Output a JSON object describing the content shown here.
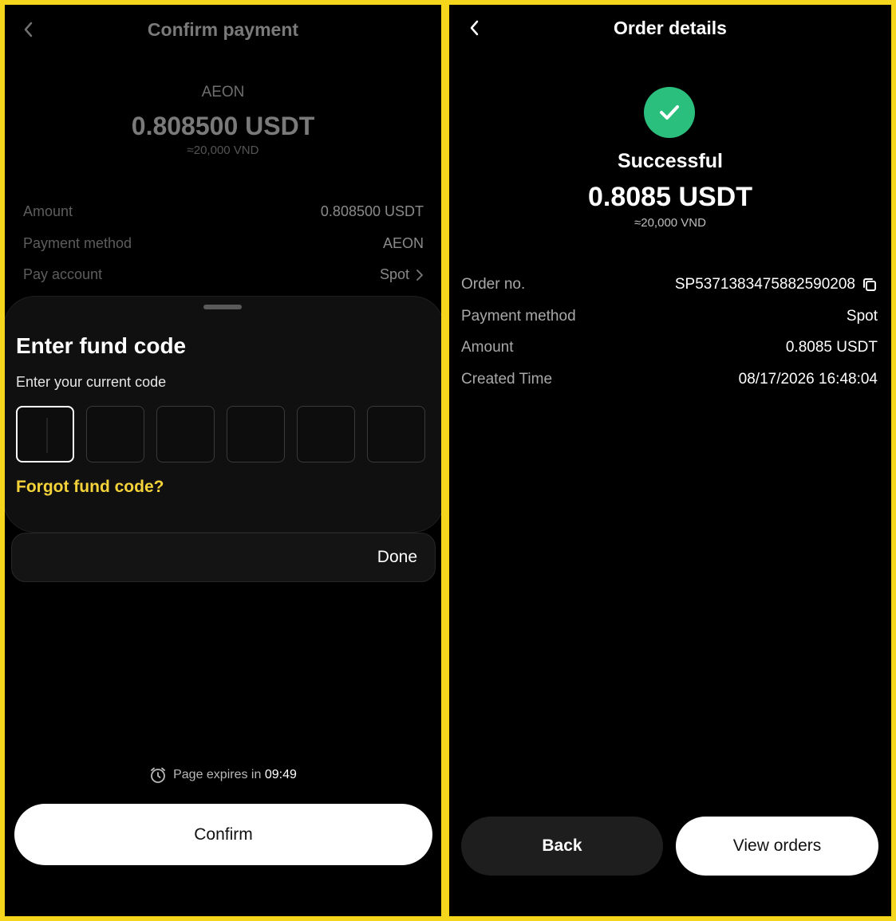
{
  "left": {
    "title": "Confirm payment",
    "merchant": "AEON",
    "amount": "0.808500 USDT",
    "approx": "≈20,000 VND",
    "rows": [
      {
        "label": "Amount",
        "value": "0.808500 USDT"
      },
      {
        "label": "Payment method",
        "value": "AEON"
      },
      {
        "label": "Pay account",
        "value": "Spot"
      }
    ],
    "sheet": {
      "title": "Enter fund code",
      "subtitle": "Enter your current code",
      "forgot": "Forgot fund code?",
      "done": "Done"
    },
    "expires_label": "Page expires in",
    "expires_time": "09:49",
    "confirm_label": "Confirm"
  },
  "right": {
    "title": "Order details",
    "status": "Successful",
    "amount": "0.8085 USDT",
    "approx": "≈20,000 VND",
    "rows": [
      {
        "label": "Order no.",
        "value": "SP5371383475882590208"
      },
      {
        "label": "Payment method",
        "value": "Spot"
      },
      {
        "label": "Amount",
        "value": "0.8085 USDT"
      },
      {
        "label": "Created Time",
        "value": "08/17/2026 16:48:04"
      }
    ],
    "back_label": "Back",
    "view_orders_label": "View orders"
  },
  "colors": {
    "border_accent": "#f5d61c",
    "link_yellow": "#f4d33a",
    "success_green": "#2bbf7d"
  }
}
